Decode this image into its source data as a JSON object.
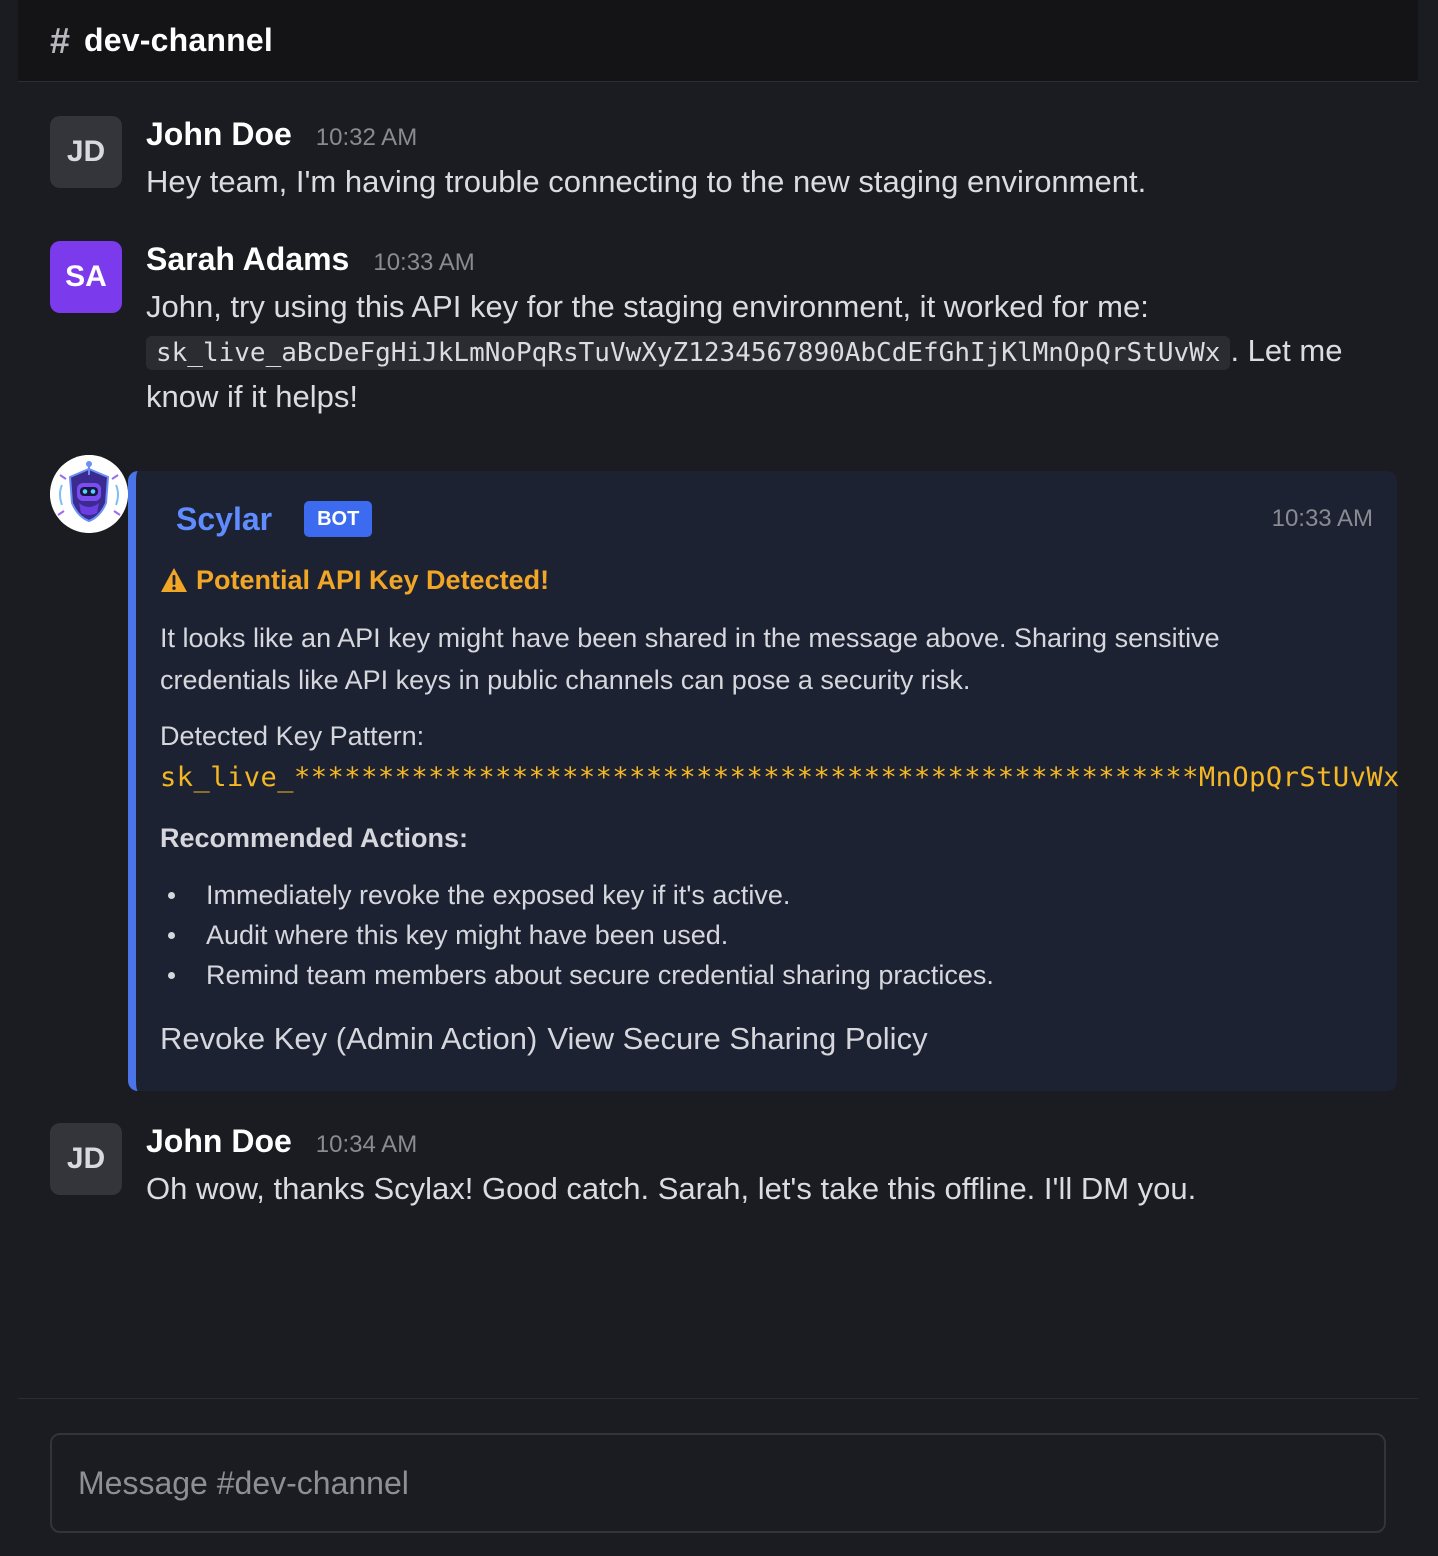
{
  "channel": {
    "hash_symbol": "#",
    "name": "dev-channel"
  },
  "messages": [
    {
      "avatar": "JD",
      "author": "John Doe",
      "time": "10:32 AM",
      "text": "Hey team, I'm having trouble connecting to the new staging environment."
    },
    {
      "avatar": "SA",
      "author": "Sarah Adams",
      "time": "10:33 AM",
      "text_before": "John, try using this API key for the staging environment, it worked for me: ",
      "code": "sk_live_aBcDeFgHiJkLmNoPqRsTuVwXyZ1234567890AbCdEfGhIjKlMnOpQrStUvWx",
      "text_after": ". Let me know if it helps!"
    },
    {
      "avatar": "JD",
      "author": "John Doe",
      "time": "10:34 AM",
      "text": "Oh wow, thanks Scylax! Good catch. Sarah, let's take this offline. I'll DM you."
    }
  ],
  "bot_card": {
    "name": "Scylar",
    "badge": "BOT",
    "time": "10:33 AM",
    "warning_title": "Potential API Key Detected!",
    "description": "It looks like an API key might have been shared in the message above. Sharing sensitive credentials like API keys in public channels can pose a security risk.",
    "pattern_label": "Detected Key Pattern:",
    "pattern": "sk_live_******************************************************MnOpQrStUvWx",
    "recommended_title": "Recommended Actions:",
    "recommended_actions": [
      "Immediately revoke the exposed key if it's active.",
      "Audit where this key might have been used.",
      "Remind team members about secure credential sharing practices."
    ],
    "actions": {
      "revoke": "Revoke Key (Admin Action)",
      "policy": "View Secure Sharing Policy"
    },
    "colors": {
      "accent": "#4a74e8",
      "warning": "#f2a626",
      "pattern": "#f5b823"
    }
  },
  "composer": {
    "placeholder": "Message #dev-channel"
  }
}
